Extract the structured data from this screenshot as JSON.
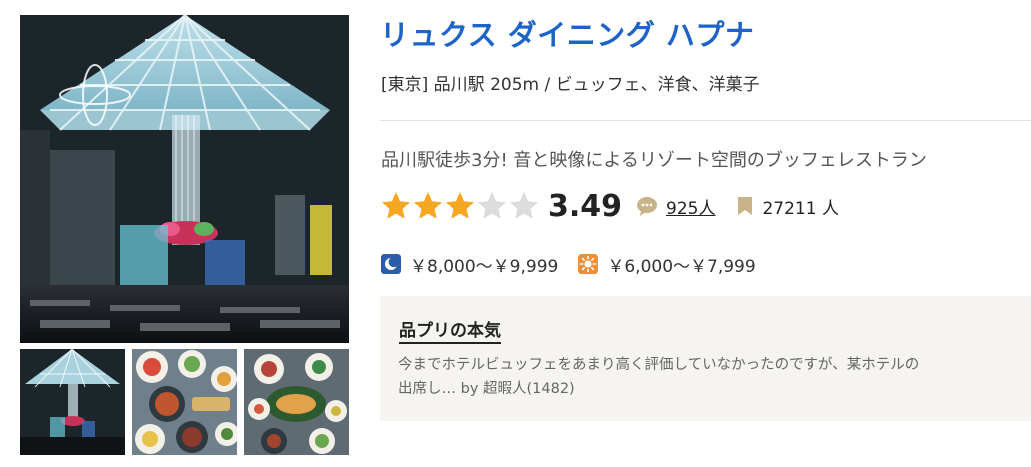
{
  "restaurant": {
    "name": "リュクス ダイニング ハプナ",
    "area": "[東京] 品川駅 205m / ビュッフェ、洋食、洋菓子",
    "catchcopy": "品川駅徒歩3分! 音と映像によるリゾート空間のブッフェレストラン",
    "rating": {
      "score": "3.49",
      "stars_value": 3.49,
      "stars_max": 5,
      "review_count": "925人",
      "save_count": "27211 人"
    },
    "prices": {
      "dinner": "￥8,000～￥9,999",
      "lunch": "￥6,000～￥7,999",
      "dinner_icon": "moon-icon",
      "lunch_icon": "sun-icon"
    },
    "review": {
      "title": "品プリの本気",
      "line1": "今までホテルビュッフェをあまり高く評価していなかったのですが、某ホテルの",
      "line2": "出席し…",
      "author": "by 超暇人(1482)"
    }
  },
  "photos": {
    "main": "restaurant-interior-photo",
    "thumbnails": [
      "interior-thumbnail",
      "buffet-dishes-thumbnail",
      "buffet-platter-thumbnail"
    ]
  },
  "colors": {
    "title": "#1d63c8",
    "star_on": "#f5a623",
    "star_off": "#dcdcdc",
    "moon_badge": "#2c5da8",
    "sun_badge": "#e8913a",
    "bookmark": "#c9b48a",
    "review_bg": "#f5f4f0"
  }
}
